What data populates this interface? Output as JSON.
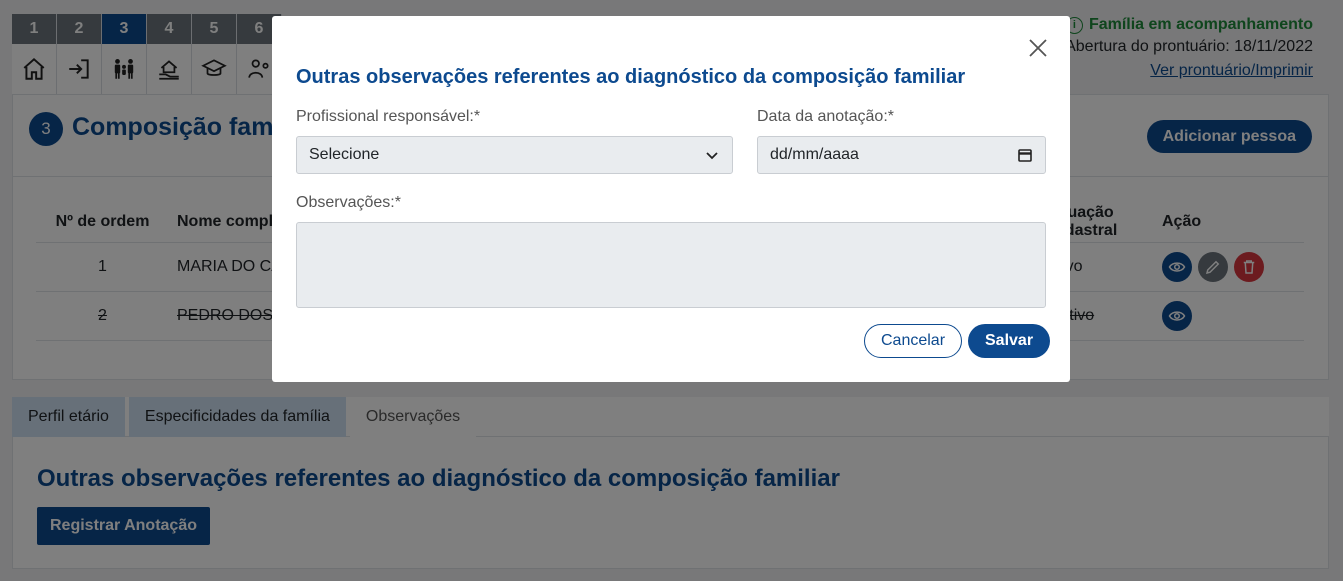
{
  "stepper": {
    "steps": [
      {
        "num": "1",
        "icon": "home-icon"
      },
      {
        "num": "2",
        "icon": "sign-in-icon"
      },
      {
        "num": "3",
        "icon": "family-icon"
      },
      {
        "num": "4",
        "icon": "house-hand-icon"
      },
      {
        "num": "5",
        "icon": "graduation-cap-icon"
      },
      {
        "num": "6",
        "icon": "worker-gear-icon"
      }
    ],
    "active": "3"
  },
  "header": {
    "status_icon": "info-icon",
    "status": "Família em acompanhamento",
    "abertura": "Abertura do prontuário: 18/11/2022",
    "ver_link": "Ver prontuário/Imprimir"
  },
  "composicao": {
    "badge": "3",
    "title": "Composição familiar",
    "add_button": "Adicionar pessoa",
    "columns": [
      "Nº de ordem",
      "Nome completo",
      "Situação cadastral",
      "Ação"
    ],
    "rows": [
      {
        "ordem": "1",
        "nome": "MARIA DO CARMO",
        "situacao": "Ativo"
      },
      {
        "ordem": "2",
        "nome": "PEDRO DOS SANTOS",
        "situacao": "Inativo"
      }
    ]
  },
  "tabs": [
    "Perfil etário",
    "Especificidades da família",
    "Observações"
  ],
  "observacoes": {
    "title": "Outras observações referentes ao diagnóstico da composição familiar",
    "register_button": "Registrar Anotação"
  },
  "modal": {
    "title": "Outras observações referentes ao diagnóstico da composição familiar",
    "profissional_label": "Profissional responsável:*",
    "profissional_value": "Selecione",
    "data_label": "Data da anotação:*",
    "data_placeholder": "dd/mm/aaaa",
    "obs_label": "Observações:*",
    "obs_value": "",
    "cancel": "Cancelar",
    "save": "Salvar"
  },
  "colors": {
    "primary": "#0d4a8f",
    "success": "#1f8a3a",
    "danger": "#d9363e",
    "secondary": "#6c757d"
  }
}
